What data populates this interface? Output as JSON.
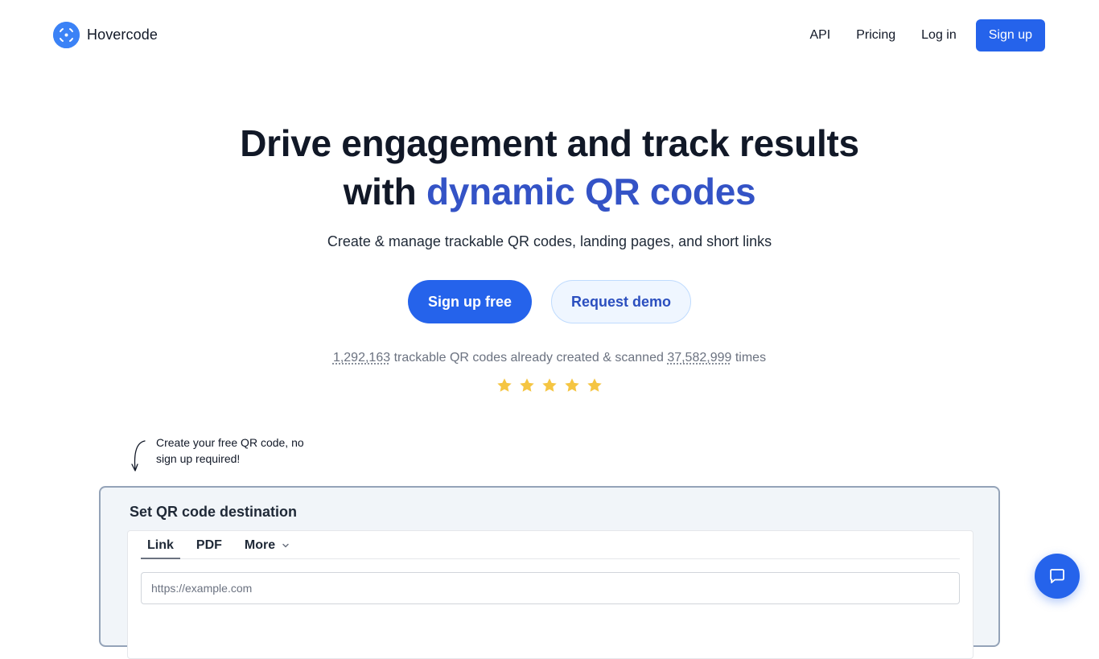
{
  "brand": {
    "name": "Hovercode",
    "color": "#3b82f6"
  },
  "nav": {
    "api": "API",
    "pricing": "Pricing",
    "login": "Log in",
    "signup": "Sign up"
  },
  "hero": {
    "title_line1": "Drive engagement and track results",
    "title_line2_prefix": "with ",
    "title_line2_accent": "dynamic QR codes",
    "subtitle": "Create & manage trackable QR codes, landing pages, and short links",
    "cta_primary": "Sign up free",
    "cta_secondary": "Request demo",
    "accent_color": "#3453c6"
  },
  "stats": {
    "codes_count": "1,292,163",
    "middle_text": " trackable QR codes already created & scanned ",
    "scans_count": "37,582,999",
    "suffix": " times",
    "rating": 5,
    "star_color": "#f5c542"
  },
  "note": {
    "text": "Create your free QR code, no sign up required!"
  },
  "qr_card": {
    "title": "Set QR code destination",
    "tabs": [
      {
        "label": "Link",
        "active": true
      },
      {
        "label": "PDF",
        "active": false
      },
      {
        "label": "More",
        "active": false
      }
    ],
    "url_placeholder": "https://example.com",
    "url_value": ""
  },
  "chat": {
    "icon": "chat-bubble-icon"
  }
}
